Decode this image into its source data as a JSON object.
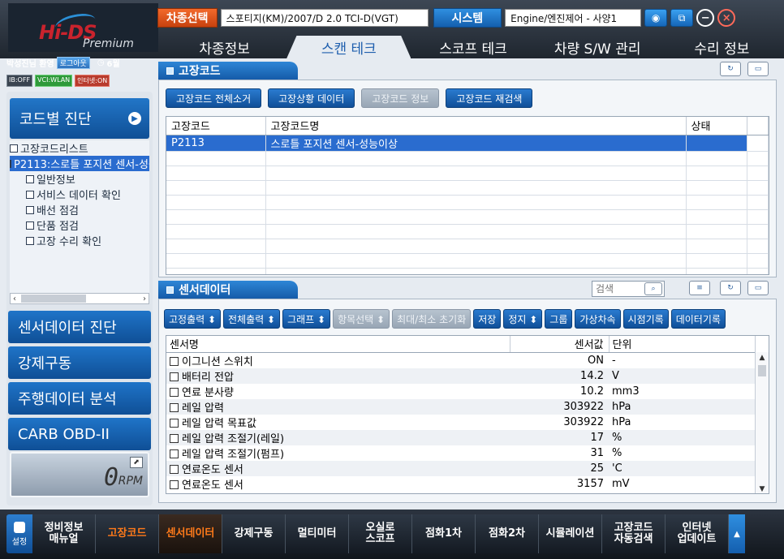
{
  "header": {
    "logo_main": "Hi-DS",
    "logo_sub": "Premium",
    "vehicle_select_label": "차종선택",
    "vehicle_value": "스포티지(KM)/2007/D 2.0 TCI-D(VGT)",
    "system_label": "시스템",
    "system_value": "Engine/엔진제어 - 사양1",
    "main_tabs": [
      "차종정보",
      "스캔 테크",
      "스코프 테크",
      "차량 S/W 관리",
      "수리 정보"
    ]
  },
  "user": {
    "greeting": "박성진님 환영",
    "logout": "로그아웃",
    "clock": "6월",
    "status": [
      "IB:OFF",
      "VCI:WLAN",
      "인터넷:ON"
    ]
  },
  "left": {
    "code_diag": "코드별 진단",
    "tree": [
      {
        "label": "고장코드리스트",
        "level": 1,
        "selected": false
      },
      {
        "label": "P2113:스로틀 포지션 센서-성능이상",
        "level": 1,
        "selected": true
      },
      {
        "label": "일반정보",
        "level": 2,
        "selected": false
      },
      {
        "label": "서비스 데이터 확인",
        "level": 2,
        "selected": false
      },
      {
        "label": "배선 점검",
        "level": 2,
        "selected": false
      },
      {
        "label": "단품 점검",
        "level": 2,
        "selected": false
      },
      {
        "label": "고장 수리 확인",
        "level": 2,
        "selected": false
      }
    ],
    "buttons": [
      "센서데이터 진단",
      "강제구동",
      "주행데이터 분석",
      "CARB OBD-II"
    ],
    "rpm_value": "0",
    "rpm_unit": "RPM"
  },
  "dtc_panel": {
    "title": "고장코드",
    "buttons": [
      {
        "label": "고장코드 전체소거",
        "disabled": false
      },
      {
        "label": "고장상황 데이터",
        "disabled": false
      },
      {
        "label": "고장코드 정보",
        "disabled": true
      },
      {
        "label": "고장코드 재검색",
        "disabled": false
      }
    ],
    "columns": [
      "고장코드",
      "고장코드명",
      "상태"
    ],
    "rows": [
      {
        "code": "P2113",
        "name": "스로틀 포지션 센서-성능이상",
        "status": ""
      }
    ]
  },
  "sensor_panel": {
    "title": "센서데이터",
    "search_placeholder": "검색",
    "buttons": [
      {
        "label": "고정출력 ⬍",
        "disabled": false
      },
      {
        "label": "전체출력 ⬍",
        "disabled": false
      },
      {
        "label": "그래프 ⬍",
        "disabled": false
      },
      {
        "label": "항목선택 ⬍",
        "disabled": true
      },
      {
        "label": "최대/최소 초기화",
        "disabled": true
      },
      {
        "label": "저장",
        "disabled": false
      },
      {
        "label": "정지 ⬍",
        "disabled": false
      },
      {
        "label": "그룹",
        "disabled": false
      },
      {
        "label": "가상차속",
        "disabled": false
      },
      {
        "label": "시점기록",
        "disabled": false
      },
      {
        "label": "데이터기록",
        "disabled": false
      }
    ],
    "columns": [
      "센서명",
      "센서값",
      "단위"
    ],
    "rows": [
      {
        "name": "이그니션 스위치",
        "value": "ON",
        "unit": "-"
      },
      {
        "name": "배터리 전압",
        "value": "14.2",
        "unit": "V"
      },
      {
        "name": "연료 분사량",
        "value": "10.2",
        "unit": "mm3"
      },
      {
        "name": "레일 압력",
        "value": "303922",
        "unit": "hPa"
      },
      {
        "name": "레일 압력 목표값",
        "value": "303922",
        "unit": "hPa"
      },
      {
        "name": "레일 압력 조절기(레일)",
        "value": "17",
        "unit": "%"
      },
      {
        "name": "레일 압력 조절기(펌프)",
        "value": "31",
        "unit": "%"
      },
      {
        "name": "연료온도 센서",
        "value": "25",
        "unit": "'C"
      },
      {
        "name": "연료온도 센서",
        "value": "3157",
        "unit": "mV"
      }
    ]
  },
  "bottombar": {
    "settings": "설정",
    "items": [
      {
        "label": "정비정보\n매뉴얼",
        "style": "normal"
      },
      {
        "label": "고장코드",
        "style": "orange"
      },
      {
        "label": "센서데이터",
        "style": "active"
      },
      {
        "label": "강제구동",
        "style": "normal"
      },
      {
        "label": "멀티미터",
        "style": "normal"
      },
      {
        "label": "오실로\n스코프",
        "style": "normal"
      },
      {
        "label": "점화1차",
        "style": "normal"
      },
      {
        "label": "점화2차",
        "style": "normal"
      },
      {
        "label": "시뮬레이션",
        "style": "normal"
      },
      {
        "label": "고장코드\n자동검색",
        "style": "normal"
      },
      {
        "label": "인터넷\n업데이트",
        "style": "normal"
      }
    ]
  }
}
